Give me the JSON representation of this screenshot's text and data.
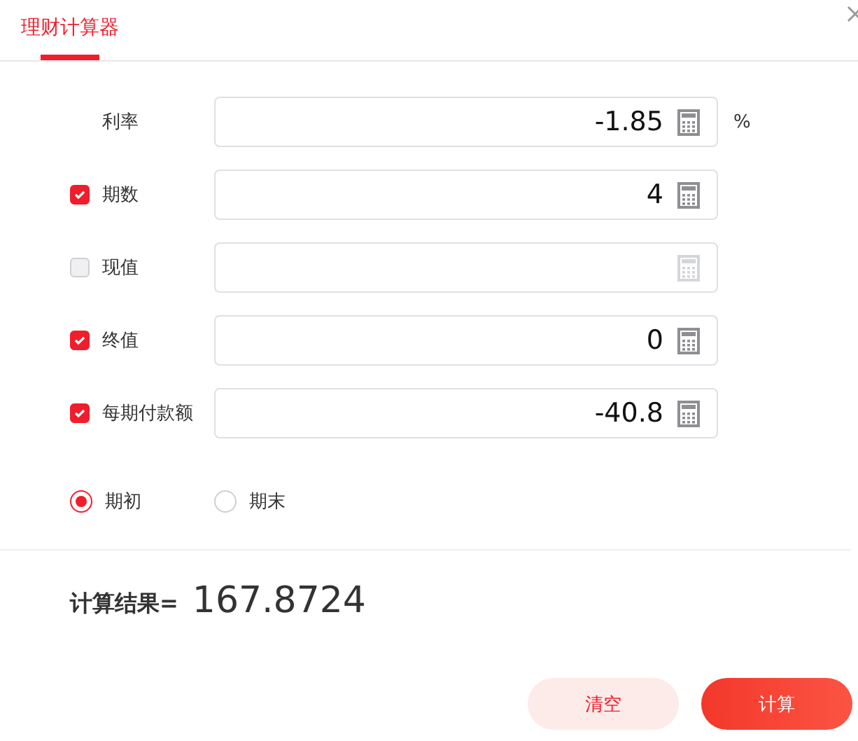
{
  "tabs": [
    {
      "label": "理财计算器",
      "selected": true
    }
  ],
  "fields": [
    {
      "kind": "plain",
      "label": "利率",
      "value": "-1.85",
      "unit": "%"
    },
    {
      "kind": "checkbox",
      "label": "期数",
      "checked": true,
      "value": "4"
    },
    {
      "kind": "checkbox",
      "label": "现值",
      "checked": false
    },
    {
      "kind": "checkbox",
      "label": "终值",
      "checked": true,
      "value": "0"
    },
    {
      "kind": "checkbox",
      "label": "每期付款额",
      "checked": true,
      "value": "-40.8"
    }
  ],
  "timing": [
    {
      "label": "期初",
      "selected": true
    },
    {
      "label": "期末",
      "selected": false
    }
  ],
  "result": {
    "label": "计算结果=",
    "value": "167.8724"
  },
  "buttons": [
    {
      "kind": "secondary",
      "label": "清空"
    },
    {
      "kind": "primary",
      "label": "计算"
    }
  ]
}
